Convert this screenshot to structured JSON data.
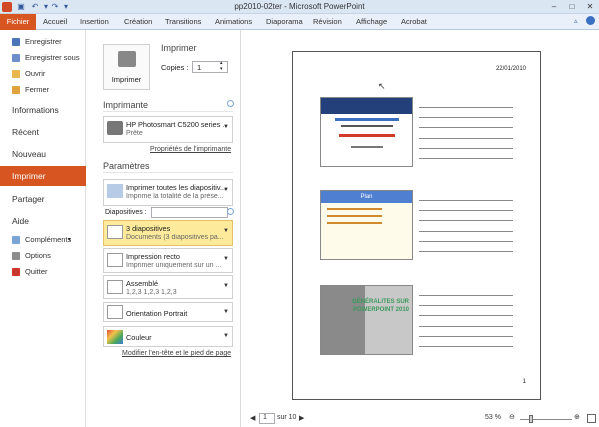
{
  "window": {
    "title": "pp2010-02ter - Microsoft PowerPoint"
  },
  "ribbon": {
    "file_tab": "Fichier",
    "tabs": [
      "Accueil",
      "Insertion",
      "Création",
      "Transitions",
      "Animations",
      "Diaporama",
      "Révision",
      "Affichage",
      "Acrobat"
    ]
  },
  "backstage": {
    "items": [
      {
        "label": "Enregistrer",
        "icon": "save-icon"
      },
      {
        "label": "Enregistrer sous",
        "icon": "save-as-icon"
      },
      {
        "label": "Ouvrir",
        "icon": "open-folder-icon"
      },
      {
        "label": "Fermer",
        "icon": "close-folder-icon"
      }
    ],
    "sections": [
      "Informations",
      "Récent",
      "Nouveau"
    ],
    "active": "Imprimer",
    "sections2": [
      "Partager",
      "Aide"
    ],
    "items2": [
      {
        "label": "Compléments",
        "icon": "addins-icon"
      },
      {
        "label": "Options",
        "icon": "options-icon"
      },
      {
        "label": "Quitter",
        "icon": "exit-icon"
      }
    ]
  },
  "print": {
    "heading": "Imprimer",
    "button_label": "Imprimer",
    "copies_label": "Copies :",
    "copies_value": "1",
    "printer_heading": "Imprimante",
    "printer_name": "HP Photosmart C5200 series ...",
    "printer_status": "Prête",
    "printer_props_link": "Propriétés de l'imprimante",
    "settings_heading": "Paramètres",
    "settings": [
      {
        "t1": "Imprimer toutes les diapositiv...",
        "t2": "Imprime la totalité de la prése..."
      },
      {
        "t1": "3 diapositives",
        "t2": "Documents (3 diapositives pa..."
      },
      {
        "t1": "Impression recto",
        "t2": "Imprimer uniquement sur un ..."
      },
      {
        "t1": "Assemblé",
        "t2": "1,2,3    1,2,3    1,2,3"
      },
      {
        "t1": "Orientation Portrait",
        "t2": ""
      },
      {
        "t1": "Couleur",
        "t2": ""
      }
    ],
    "slides_label": "Diapositives :",
    "header_footer_link": "Modifier l'en-tête et le pied de page"
  },
  "preview": {
    "date": "22/01/2010",
    "page_number": "1",
    "page_input": "1",
    "page_total": "sur 10",
    "zoom": "53 %",
    "slide3_title": "GÉNÉRALITES SUR POWERPOINT 2010",
    "slide2_title": "Plan"
  },
  "colors": {
    "accent": "#d65521",
    "ribbon_bg": "#e9f0f9"
  }
}
